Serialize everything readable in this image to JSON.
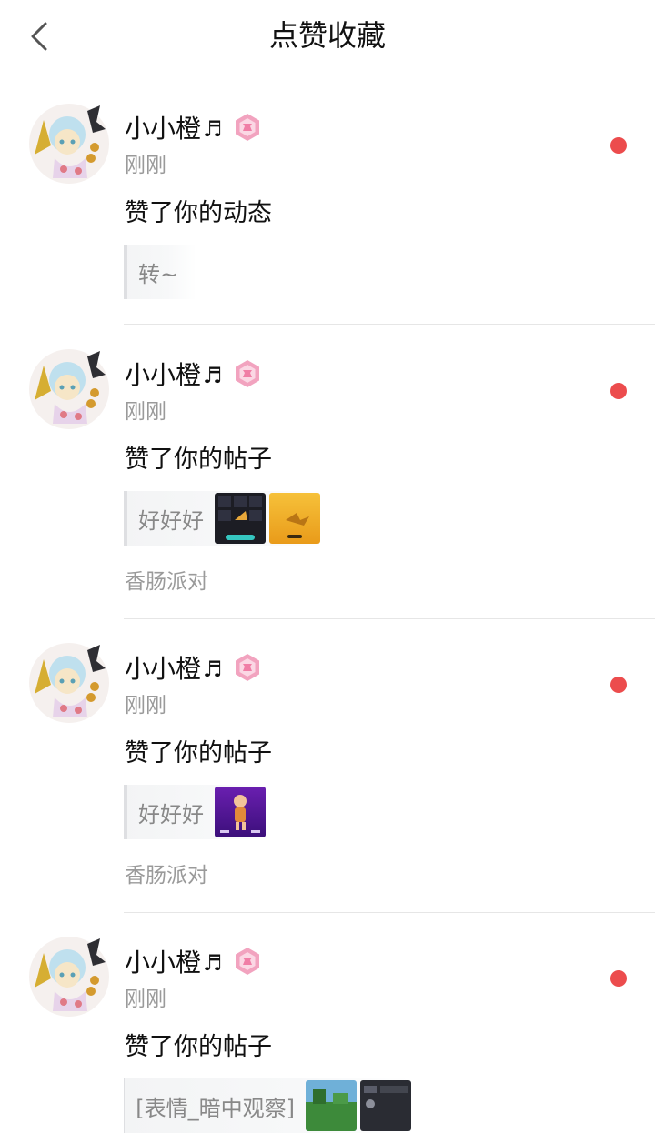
{
  "header": {
    "title": "点赞收藏"
  },
  "items": [
    {
      "username": "小小橙",
      "note": "♬",
      "time": "刚刚",
      "action": "赞了你的动态",
      "quote": "转~",
      "tag": ""
    },
    {
      "username": "小小橙",
      "note": "♬",
      "time": "刚刚",
      "action": "赞了你的帖子",
      "quote": "好好好",
      "tag": "香肠派对"
    },
    {
      "username": "小小橙",
      "note": "♬",
      "time": "刚刚",
      "action": "赞了你的帖子",
      "quote": "好好好",
      "tag": "香肠派对"
    },
    {
      "username": "小小橙",
      "note": "♬",
      "time": "刚刚",
      "action": "赞了你的帖子",
      "quote": "[表情_暗中观察]",
      "tag": ""
    }
  ],
  "colors": {
    "unread_dot": "#ec4c4d",
    "badge": "#f2a3bf",
    "muted_text": "#9a9a9a"
  }
}
